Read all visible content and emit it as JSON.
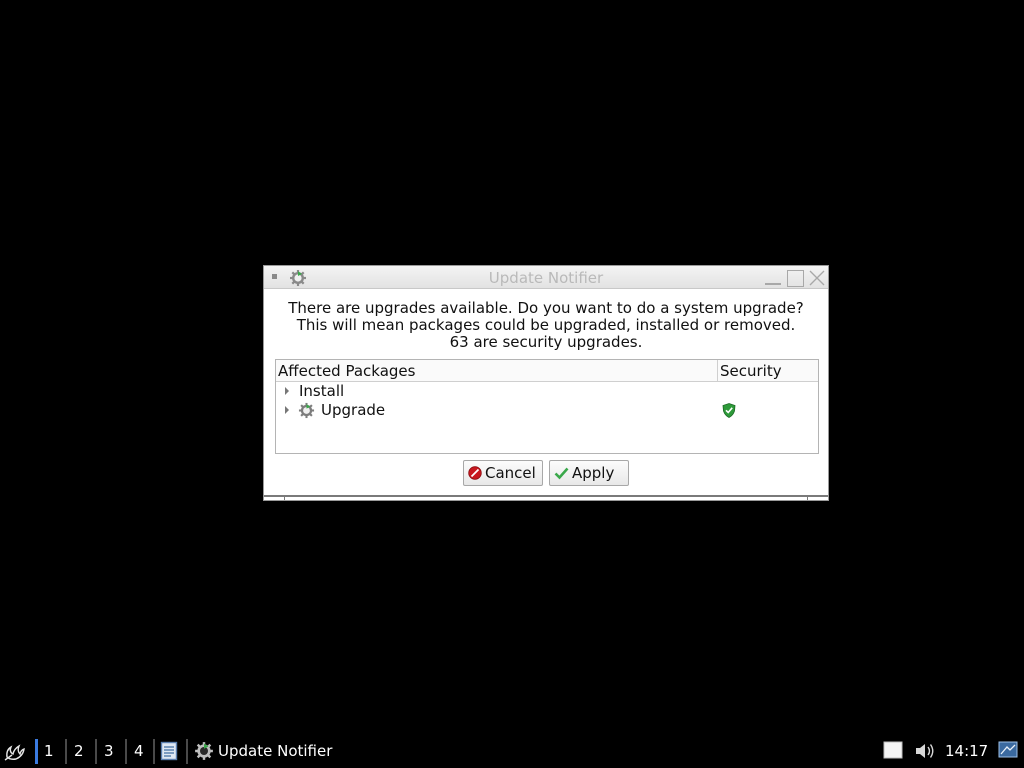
{
  "window": {
    "title": "Update Notifier",
    "message": {
      "line1": "There are upgrades available. Do you want to do a system upgrade?",
      "line2": "This will mean packages could be upgraded, installed or removed.",
      "line3": "63 are security upgrades."
    },
    "tree": {
      "columns": {
        "packages": "Affected Packages",
        "security": "Security"
      },
      "rows": [
        {
          "label": "Install",
          "icon": null,
          "security_icon": null
        },
        {
          "label": "Upgrade",
          "icon": "update-gear-icon",
          "security_icon": "green-shield-icon"
        }
      ]
    },
    "buttons": {
      "cancel": "Cancel",
      "apply": "Apply"
    }
  },
  "taskbar": {
    "workspaces": [
      "1",
      "2",
      "3",
      "4"
    ],
    "active_workspace": "1",
    "task": {
      "label": "Update Notifier",
      "icon": "update-gear-icon"
    },
    "clock": "14:17",
    "tray_icons": [
      "clipboard-icon",
      "volume-icon",
      "network-icon"
    ]
  },
  "colors": {
    "desktop": "#000000",
    "active_workspace_marker": "#3b7be0",
    "shield_green": "#2e9a3a",
    "cancel_red": "#c8171e",
    "apply_green": "#3aa84a"
  }
}
